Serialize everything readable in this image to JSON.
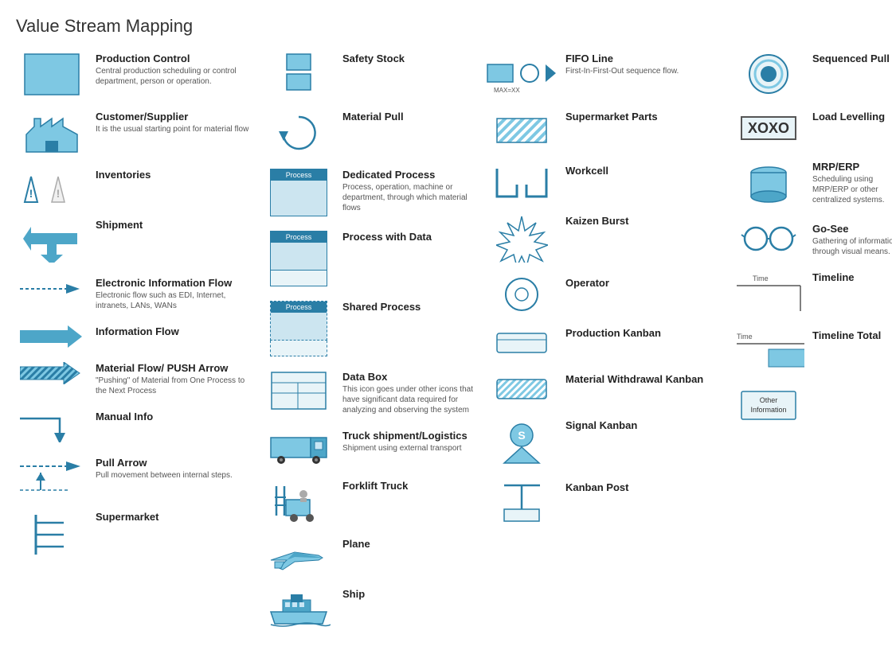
{
  "page": {
    "title": "Value Stream Mapping"
  },
  "items": {
    "col1": [
      {
        "name": "production-control",
        "title": "Production Control",
        "desc": "Central production scheduling or control department, person or operation."
      },
      {
        "name": "customer-supplier",
        "title": "Customer/Supplier",
        "desc": "It is the usual starting point for material flow"
      },
      {
        "name": "inventories",
        "title": "Inventories",
        "desc": ""
      },
      {
        "name": "shipment",
        "title": "Shipment",
        "desc": ""
      },
      {
        "name": "electronic-info-flow",
        "title": "Electronic Information Flow",
        "desc": "Electronic flow such as EDI, Internet, intranets, LANs, WANs"
      },
      {
        "name": "information-flow",
        "title": "Information Flow",
        "desc": ""
      },
      {
        "name": "material-flow-push",
        "title": "Material Flow/ PUSH Arrow",
        "desc": "\"Pushing\" of Material from One Process to the Next Process"
      },
      {
        "name": "manual-info",
        "title": "Manual Info",
        "desc": ""
      },
      {
        "name": "pull-arrow",
        "title": "Pull Arrow",
        "desc": "Pull movement between internal steps."
      },
      {
        "name": "supermarket",
        "title": "Supermarket",
        "desc": ""
      }
    ],
    "col2": [
      {
        "name": "safety-stock",
        "title": "Safety Stock",
        "desc": ""
      },
      {
        "name": "material-pull",
        "title": "Material Pull",
        "desc": ""
      },
      {
        "name": "dedicated-process",
        "title": "Dedicated Process",
        "desc": "Process, operation, machine or department, through which material flows"
      },
      {
        "name": "process-with-data",
        "title": "Process with Data",
        "desc": ""
      },
      {
        "name": "shared-process",
        "title": "Shared Process",
        "desc": ""
      },
      {
        "name": "data-box",
        "title": "Data Box",
        "desc": "This icon goes under other icons that have significant data required for analyzing and observing the system"
      },
      {
        "name": "truck-shipment",
        "title": "Truck shipment/Logistics",
        "desc": "Shipment using external transport"
      },
      {
        "name": "forklift-truck",
        "title": "Forklift Truck",
        "desc": ""
      },
      {
        "name": "plane",
        "title": "Plane",
        "desc": ""
      },
      {
        "name": "ship",
        "title": "Ship",
        "desc": ""
      }
    ],
    "col3": [
      {
        "name": "fifo-line",
        "title": "FIFO Line",
        "desc": "First-In-First-Out sequence flow.",
        "extra": "MAX=XX"
      },
      {
        "name": "supermarket-parts",
        "title": "Supermarket Parts",
        "desc": ""
      },
      {
        "name": "workcell",
        "title": "Workcell",
        "desc": ""
      },
      {
        "name": "kaizen-burst",
        "title": "Kaizen Burst",
        "desc": ""
      },
      {
        "name": "operator",
        "title": "Operator",
        "desc": ""
      },
      {
        "name": "production-kanban",
        "title": "Production Kanban",
        "desc": ""
      },
      {
        "name": "material-withdrawal-kanban",
        "title": "Material Withdrawal Kanban",
        "desc": ""
      },
      {
        "name": "signal-kanban",
        "title": "Signal Kanban",
        "desc": ""
      },
      {
        "name": "kanban-post",
        "title": "Kanban Post",
        "desc": ""
      }
    ],
    "col4": [
      {
        "name": "sequenced-pull",
        "title": "Sequenced Pull",
        "desc": ""
      },
      {
        "name": "load-levelling",
        "title": "Load Levelling",
        "desc": ""
      },
      {
        "name": "mrp-erp",
        "title": "MRP/ERP",
        "desc": "Scheduling using MRP/ERP or other centralized systems."
      },
      {
        "name": "go-see",
        "title": "Go-See",
        "desc": "Gathering of information through visual means."
      },
      {
        "name": "timeline",
        "title": "Timeline",
        "desc": "",
        "extra": "Time"
      },
      {
        "name": "timeline-total",
        "title": "Timeline Total",
        "desc": "",
        "extra": "Time"
      },
      {
        "name": "other-information",
        "title": "Other Information",
        "desc": ""
      }
    ]
  }
}
